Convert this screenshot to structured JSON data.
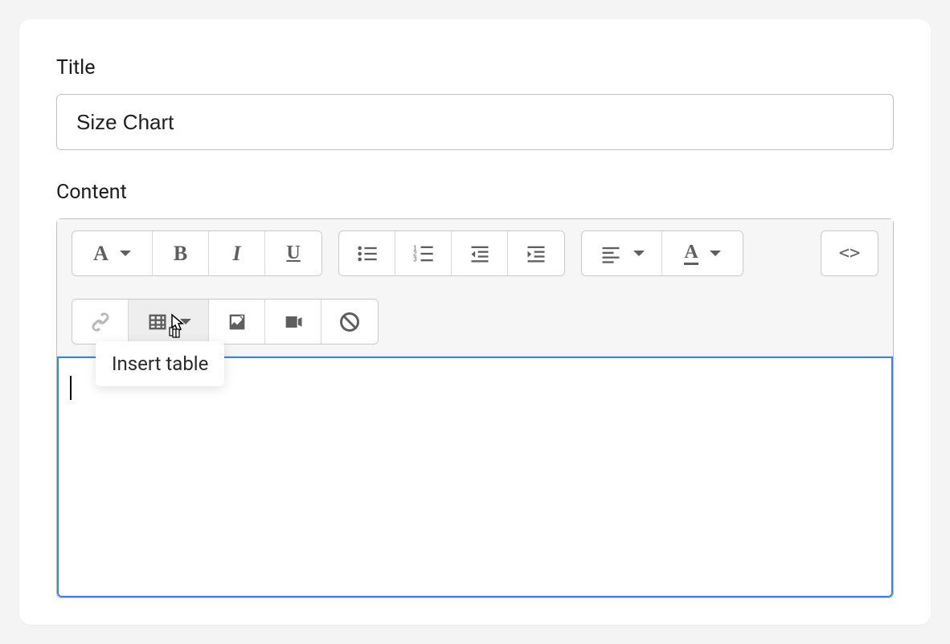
{
  "title": {
    "label": "Title",
    "value": "Size Chart"
  },
  "content": {
    "label": "Content",
    "body": ""
  },
  "tooltip": {
    "insert_table": "Insert table"
  },
  "toolbar": {
    "row1": {
      "format_style": "A",
      "bold": "B",
      "italic": "I",
      "underline": "U",
      "bullet_list": "bullet-list",
      "numbered_list": "numbered-list",
      "outdent": "outdent",
      "indent": "indent",
      "align": "align-left",
      "text_color": "A",
      "code_view": "<>"
    },
    "row2": {
      "link": "link",
      "table": "table",
      "image": "image",
      "video": "video",
      "clear_format": "clear"
    }
  }
}
